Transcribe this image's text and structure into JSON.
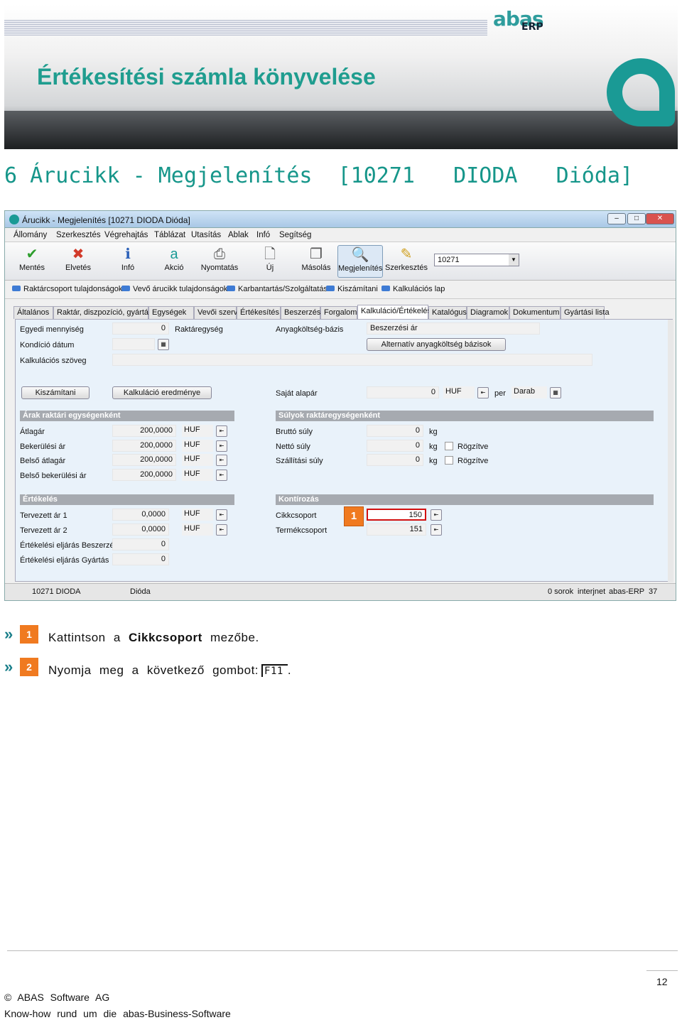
{
  "header": {
    "logo": "abas",
    "logo_sub": "ERP",
    "title": "Értékesítési számla könyvelése"
  },
  "heading": "6 Árucikk - Megjelenítés  [10271   DIODA   Dióda]",
  "window": {
    "title": "Árucikk - Megjelenítés [10271  DIODA  Dióda]",
    "controls": [
      "–",
      "□",
      "✕"
    ],
    "menu": [
      "Állomány",
      "Szerkesztés",
      "Végrehajtás",
      "Táblázat",
      "Utasítás",
      "Ablak",
      "Infó",
      "Segítség"
    ],
    "toolbar": [
      {
        "label": "Mentés",
        "icon": "check-icon",
        "glyph": "✔",
        "color": "#2e9e2e"
      },
      {
        "label": "Elvetés",
        "icon": "cancel-icon",
        "glyph": "✖",
        "color": "#d23a2a"
      },
      {
        "label": "Infó",
        "icon": "info-icon",
        "glyph": "ℹ",
        "color": "#2a5fb8"
      },
      {
        "label": "Akció",
        "icon": "abas-action-icon",
        "glyph": "a",
        "color": "#1a9a95"
      },
      {
        "label": "Nyomtatás",
        "icon": "printer-icon",
        "glyph": "⎙",
        "color": "#555"
      },
      {
        "label": "Új",
        "icon": "new-document-icon",
        "glyph": "🗋",
        "color": "#555"
      },
      {
        "label": "Másolás",
        "icon": "copy-icon",
        "glyph": "❐",
        "color": "#555"
      },
      {
        "label": "Megjelenítés",
        "icon": "magnifier-icon",
        "glyph": "🔍",
        "color": "#2a5fb8"
      },
      {
        "label": "Szerkesztés",
        "icon": "edit-icon",
        "glyph": "✎",
        "color": "#d0a020"
      }
    ],
    "combo_value": "10271",
    "links": [
      "Raktárcsoport tulajdonságok",
      "Vevő árucikk tulajdonságok",
      "Karbantartás/Szolgáltatás",
      "Kiszámítani",
      "Kalkulációs lap"
    ],
    "tabs": [
      "Általános",
      "Raktár, diszpozíció, gyártás",
      "Egységek",
      "Vevői szerviz",
      "Értékesítés",
      "Beszerzés",
      "Forgalom",
      "Kalkuláció/Értékelés",
      "Katalógus",
      "Diagramok",
      "Dokumentum",
      "Gyártási lista"
    ],
    "form": {
      "egyedi_label": "Egyedi mennyiség",
      "egyedi_value": "0",
      "raktaregyseg_label": "Raktáregység",
      "kondicio_label": "Kondíció dátum",
      "kalk_szoveg_label": "Kalkulációs szöveg",
      "anyag_label": "Anyagköltség-bázis",
      "anyag_value": "Beszerzési ár",
      "alt_button": "Alternatív anyagköltség bázisok",
      "kiszamitani_button": "Kiszámítani",
      "kalk_eredmeny_button": "Kalkuláció eredménye",
      "sajat_label": "Saját alapár",
      "sajat_value": "0",
      "sajat_unit": "HUF",
      "per_label": "per",
      "per_unit": "Darab",
      "arak_section": "Árak raktári egységenként",
      "arak": [
        {
          "label": "Átlagár",
          "value": "200,0000",
          "unit": "HUF"
        },
        {
          "label": "Bekerülési ár",
          "value": "200,0000",
          "unit": "HUF"
        },
        {
          "label": "Belső átlagár",
          "value": "200,0000",
          "unit": "HUF"
        },
        {
          "label": "Belső bekerülési ár",
          "value": "200,0000",
          "unit": "HUF"
        }
      ],
      "sulyok_section": "Súlyok raktáregységenként",
      "sulyok": [
        {
          "label": "Bruttó súly",
          "value": "0",
          "unit": "kg",
          "check": ""
        },
        {
          "label": "Nettó súly",
          "value": "0",
          "unit": "kg",
          "check": "Rögzítve"
        },
        {
          "label": "Szállítási súly",
          "value": "0",
          "unit": "kg",
          "check": "Rögzítve"
        }
      ],
      "ertekeles_section": "Értékelés",
      "ertekeles": [
        {
          "label": "Tervezett ár 1",
          "value": "0,0000",
          "unit": "HUF"
        },
        {
          "label": "Tervezett ár 2",
          "value": "0,0000",
          "unit": "HUF"
        },
        {
          "label": "Értékelési eljárás Beszerzés",
          "value": "0",
          "unit": ""
        },
        {
          "label": "Értékelési eljárás Gyártás",
          "value": "0",
          "unit": ""
        }
      ],
      "kont_section": "Kontírozás",
      "kont": [
        {
          "label": "Cikkcsoport",
          "value": "150"
        },
        {
          "label": "Termékcsoport",
          "value": "151"
        }
      ],
      "marker": "1"
    },
    "status": [
      "10271 DIODA",
      "Dióda",
      "0 sorok",
      "interjnet",
      "abas-ERP",
      "37"
    ]
  },
  "steps": [
    {
      "num": "1",
      "arrow": "»",
      "text_pre": "Kattintson  a ",
      "text_bold": "Cikkcsoport",
      "text_post": " mezőbe."
    },
    {
      "num": "2",
      "arrow": "»",
      "text_pre": "Nyomja  meg  a  következő  gombot:",
      "key": "F11",
      "text_post": "."
    }
  ],
  "footer": {
    "page": "12",
    "copyright": "© ABAS Software AG",
    "tagline": "Know-how rund um die abas-Business-Software"
  }
}
